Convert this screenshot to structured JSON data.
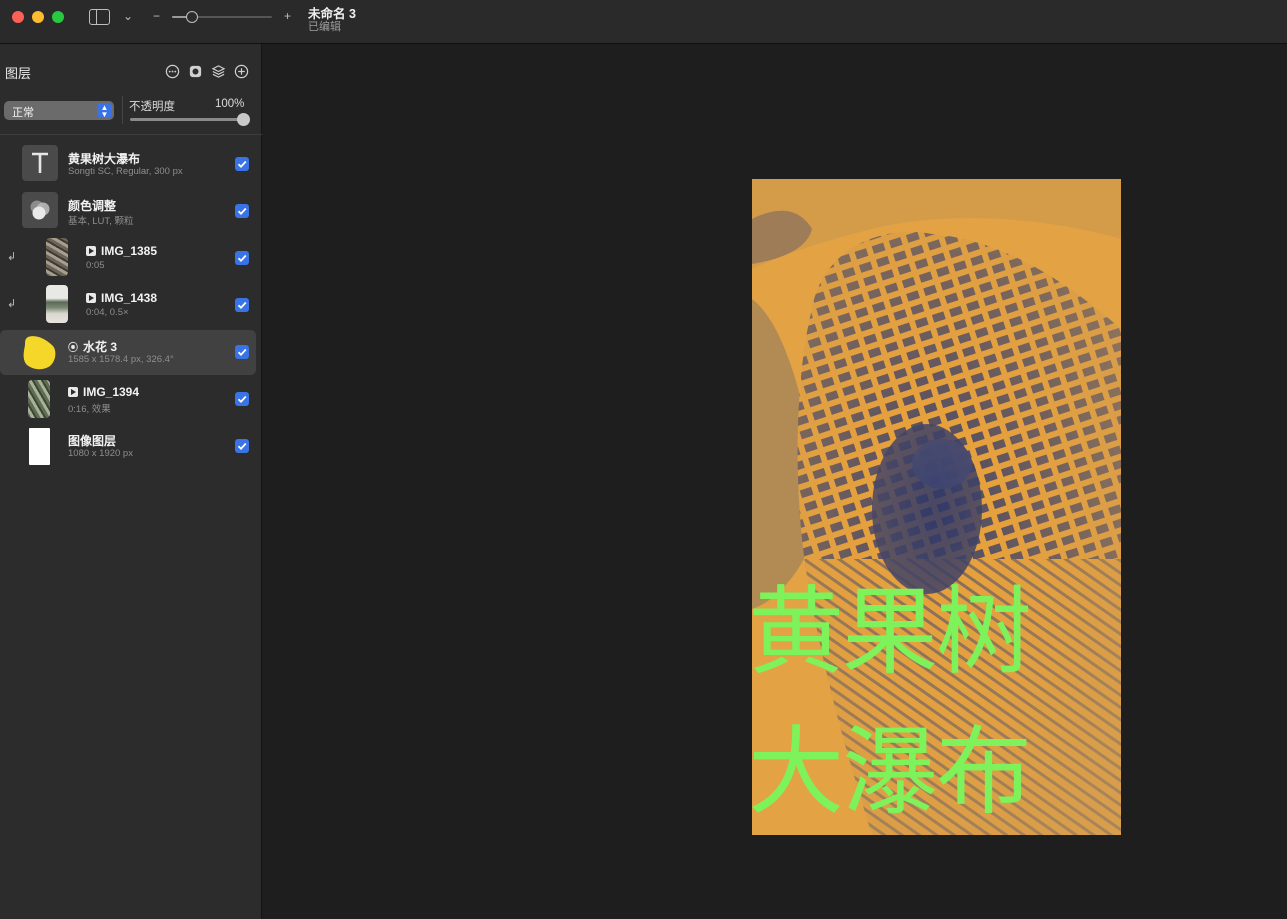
{
  "window": {
    "title": "未命名 3",
    "subtitle": "已编辑",
    "zoom_minus": "−",
    "zoom_plus": "+",
    "zoom_level": 0.2
  },
  "layers_panel": {
    "title": "图层",
    "blend_mode": "正常",
    "opacity_label": "不透明度",
    "opacity_value": "100%",
    "opacity_fraction": 1.0,
    "layers": [
      {
        "name": "黄果树大瀑布",
        "meta": "Songti SC, Regular, 300 px",
        "type": "text",
        "visible": true,
        "selected": false,
        "clipped": false
      },
      {
        "name": "颜色调整",
        "meta": "基本, LUT, 颗粒",
        "type": "adjustment",
        "visible": true,
        "selected": false,
        "clipped": false
      },
      {
        "name": "IMG_1385",
        "meta": "0:05",
        "type": "video",
        "visible": true,
        "selected": false,
        "clipped": true
      },
      {
        "name": "IMG_1438",
        "meta": "0:04, 0.5×",
        "type": "video",
        "visible": true,
        "selected": false,
        "clipped": true
      },
      {
        "name": "水花 3",
        "meta": "1585 x 1578.4 px, 326.4°",
        "type": "shape",
        "visible": true,
        "selected": true,
        "clipped": false
      },
      {
        "name": "IMG_1394",
        "meta": "0:16, 效果",
        "type": "video",
        "visible": true,
        "selected": false,
        "clipped": false
      },
      {
        "name": "图像图层",
        "meta": "1080 x 1920 px",
        "type": "image",
        "visible": true,
        "selected": false,
        "clipped": false
      }
    ]
  },
  "canvas": {
    "text_line1": "黄果树",
    "text_line2": "大瀑布",
    "duotone_light": "#e9a23b",
    "duotone_dark": "#1e2f6e",
    "text_color": "#7df25a",
    "shape_color": "#f5d72a"
  },
  "colors": {
    "accent": "#3a73e6",
    "selected_row": "#414141"
  }
}
